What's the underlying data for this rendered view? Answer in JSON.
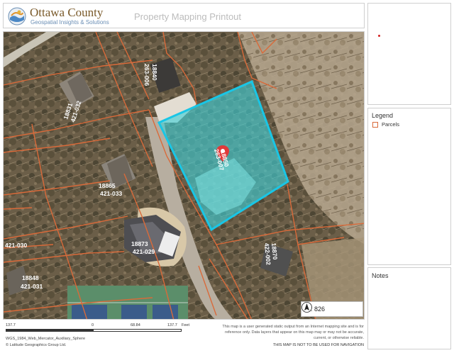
{
  "header": {
    "org_name": "Ottawa County",
    "org_tagline": "Geospatial Insights & Solutions",
    "print_title": "Property Mapping Printout"
  },
  "legend": {
    "title": "Legend",
    "items": [
      {
        "label": "Parcels",
        "color": "#d96a3a"
      }
    ]
  },
  "notes": {
    "title": "Notes"
  },
  "map": {
    "scale_text": "1: 826",
    "north_icon": "north-arrow-icon",
    "selected_parcel_fill": "#3fd1d8",
    "selected_parcel_outline": "#19c6e6",
    "parcel_line_color": "#d96a3a",
    "marker_color": "#e03a3a",
    "parcels": [
      {
        "number": "18840",
        "id": "263-006"
      },
      {
        "number": "18831",
        "id": "421-032"
      },
      {
        "number": "18850",
        "id": "263-007"
      },
      {
        "number": "18865",
        "id": "421-033"
      },
      {
        "number": "18873",
        "id": "421-029"
      },
      {
        "number": "18870",
        "id": "422-002"
      },
      {
        "number": "18848",
        "id": "421-031"
      },
      {
        "number": "",
        "id": "421-030"
      }
    ]
  },
  "scalebar": {
    "labels": [
      "137.7",
      "0",
      "68.84",
      "137.7",
      "Feet"
    ]
  },
  "footer": {
    "projection": "WGS_1984_Web_Mercator_Auxiliary_Sphere",
    "copyright": "© Latitude Geographics Group Ltd.",
    "disclaimer": "This map is a user generated static output from an Internet mapping site and is for reference only. Data layers that appear on this map may or may not be accurate, current, or otherwise reliable.",
    "nav_warning": "THIS MAP IS NOT TO BE USED FOR NAVIGATION"
  }
}
